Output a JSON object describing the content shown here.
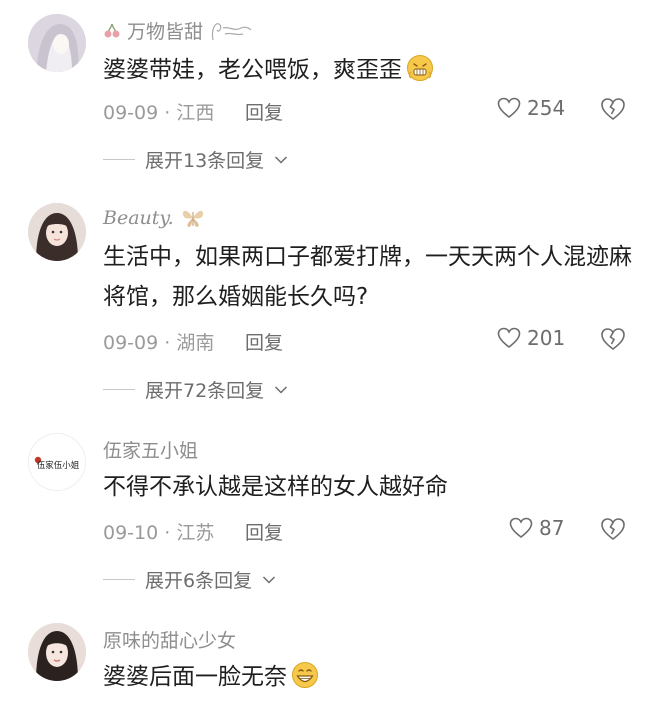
{
  "comments": [
    {
      "username": "万物皆甜",
      "text": "婆婆带娃，老公喂饭，爽歪歪",
      "date": "09-09",
      "location": "江西",
      "reply_label": "回复",
      "likes": "254",
      "expand_label": "展开13条回复"
    },
    {
      "username": "Beauty.",
      "text": "生活中，如果两口子都爱打牌，一天天两个人混迹麻将馆，那么婚姻能长久吗?",
      "date": "09-09",
      "location": "湖南",
      "reply_label": "回复",
      "likes": "201",
      "expand_label": "展开72条回复"
    },
    {
      "username": "伍家五小姐",
      "text": "不得不承认越是这样的女人越好命",
      "date": "09-10",
      "location": "江苏",
      "reply_label": "回复",
      "likes": "87",
      "expand_label": "展开6条回复",
      "avatar_logo_text": "伍家伍小姐"
    },
    {
      "username": "原味的甜心少女",
      "text": "婆婆后面一脸无奈",
      "date": "",
      "location": "",
      "reply_label": "",
      "likes": "",
      "expand_label": ""
    }
  ],
  "colors": {
    "username": "#8e8e8e",
    "body_text": "#1f1f1f",
    "meta": "#9a9a9a",
    "action": "#6d6d6d",
    "divider": "#c8c8c8"
  },
  "icons": [
    "cherry-icon",
    "butterfly-icon",
    "heart-icon",
    "broken-heart-icon",
    "chevron-down-icon",
    "emoji-grimace-icon",
    "emoji-grin-icon"
  ]
}
